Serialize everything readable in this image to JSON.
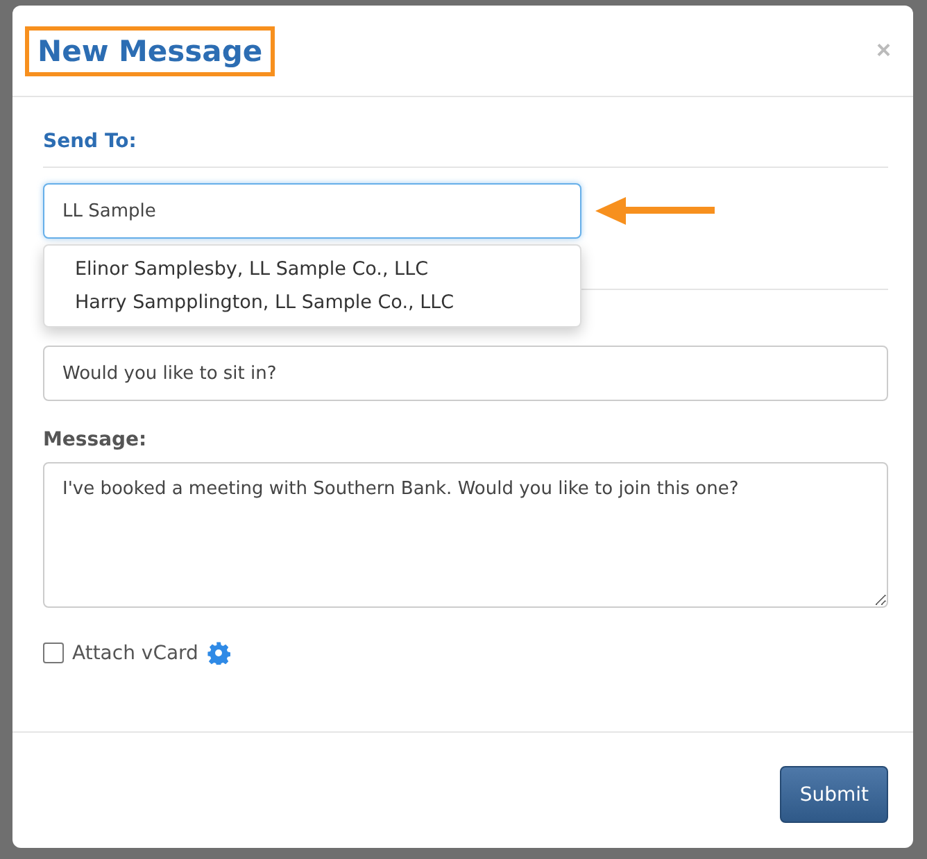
{
  "dialog": {
    "title": "New Message",
    "close": "×"
  },
  "send_to": {
    "label": "Send To:",
    "value": "LL Sample",
    "suggestions": [
      {
        "text": "Elinor Samplesby, LL Sample Co., LLC"
      },
      {
        "text": "Harry Sampplington, LL Sample Co., LLC"
      }
    ]
  },
  "subject": {
    "value": "Would you like to sit in?"
  },
  "message": {
    "label": "Message:",
    "value": "I've booked a meeting with Southern Bank. Would you like to join this one?"
  },
  "attach_vcard": {
    "label": "Attach vCard",
    "checked": false
  },
  "submit": "Submit"
}
